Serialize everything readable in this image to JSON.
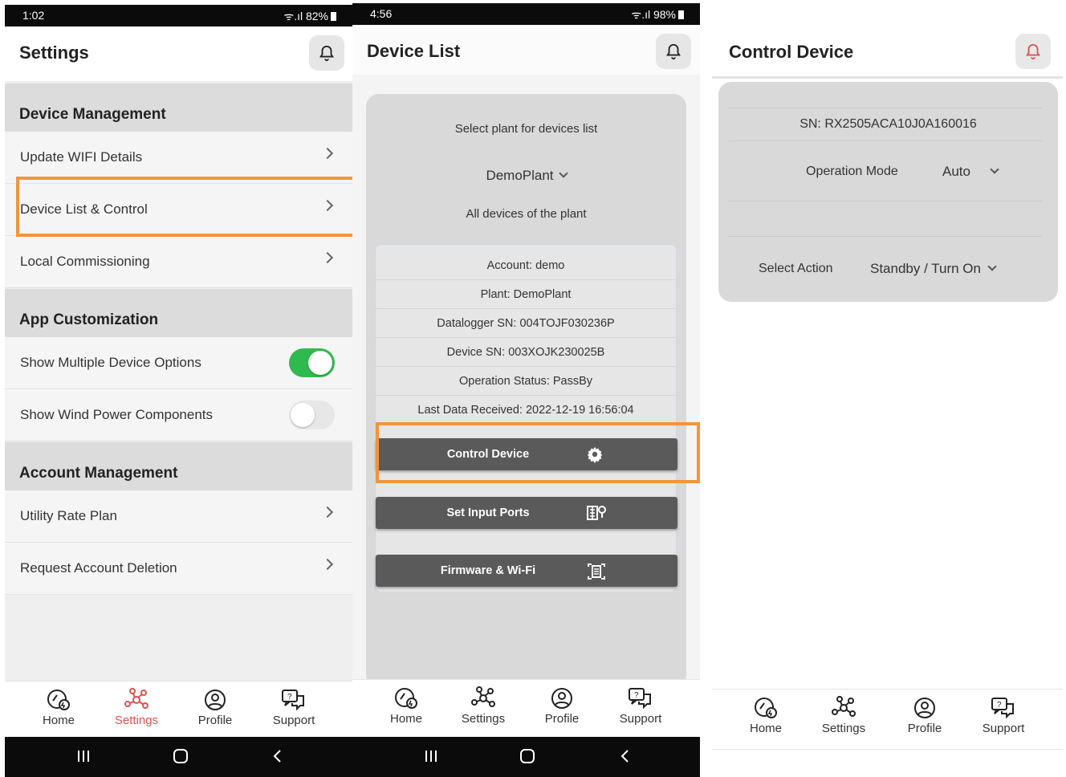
{
  "screen1": {
    "status": {
      "time": "1:02",
      "battery": "82%"
    },
    "title": "Settings",
    "sections": [
      {
        "heading": "Device Management",
        "rows": [
          "Update WIFI Details",
          "Device List & Control",
          "Local Commissioning"
        ]
      },
      {
        "heading": "App Customization",
        "toggles": [
          {
            "label": "Show Multiple Device Options",
            "on": true
          },
          {
            "label": "Show Wind Power Components",
            "on": false
          }
        ]
      },
      {
        "heading": "Account Management",
        "rows": [
          "Utility Rate Plan",
          "Request Account Deletion"
        ]
      }
    ],
    "nav": [
      "Home",
      "Settings",
      "Profile",
      "Support"
    ],
    "active_nav": "Settings"
  },
  "screen2": {
    "status": {
      "time": "4:56",
      "battery": "98%"
    },
    "title": "Device List",
    "select_label": "Select plant for devices list",
    "plant": "DemoPlant",
    "all_devices_label": "All devices of the plant",
    "info": [
      "Account: demo",
      "Plant: DemoPlant",
      "Datalogger SN: 004TOJF030236P",
      "Device SN: 003XOJK230025B",
      "Operation Status: PassBy",
      "Last Data Received: 2022-12-19 16:56:04"
    ],
    "buttons": [
      "Control Device",
      "Set Input Ports",
      "Firmware & Wi-Fi"
    ],
    "nav": [
      "Home",
      "Settings",
      "Profile",
      "Support"
    ]
  },
  "screen3": {
    "title": "Control Device",
    "sn": "SN: RX2505ACA10J0A160016",
    "operation_mode_label": "Operation Mode",
    "operation_mode_value": "Auto",
    "select_action_label": "Select Action",
    "select_action_value": "Standby / Turn On",
    "nav": [
      "Home",
      "Settings",
      "Profile",
      "Support"
    ]
  },
  "colors": {
    "highlight": "#f0953e",
    "toggle_on": "#2fba4f",
    "active_nav": "#d9534f",
    "button": "#5a5a5a"
  },
  "icons": [
    "bell-icon",
    "chevron-right-icon",
    "chevron-down-icon",
    "gear-icon",
    "ports-icon",
    "firmware-icon",
    "home-icon",
    "settings-icon",
    "profile-icon",
    "support-icon"
  ]
}
